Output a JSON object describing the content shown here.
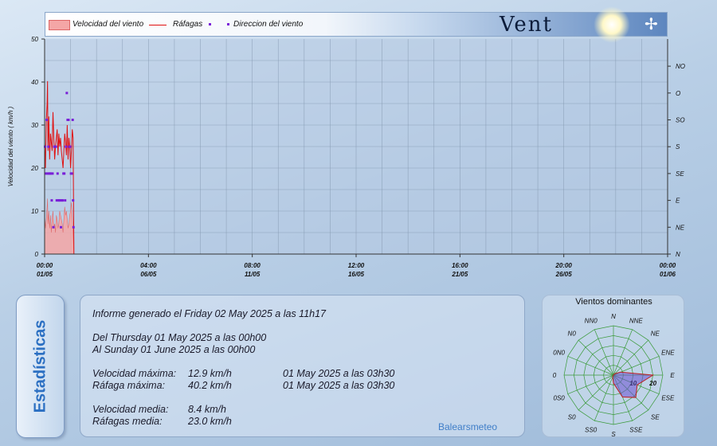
{
  "header": {
    "title": "Vent",
    "legend": [
      {
        "label": "Velocidad del viento",
        "symbol": "area",
        "color": "#f4a6a6"
      },
      {
        "label": "Ráfagas",
        "symbol": "line",
        "color": "#e01010"
      },
      {
        "label": "Direccion del viento",
        "symbol": "dots",
        "color": "#7a20d8"
      }
    ]
  },
  "colors": {
    "speed_fill": "#f4a6a6",
    "gust_line": "#e01010",
    "direction": "#7a20d8",
    "grid": "#7f93ab"
  },
  "chart_data": {
    "type": "line",
    "ylabel": "Velocidad del viento  ( km/h )",
    "ylim": [
      0,
      50
    ],
    "yticks": [
      "0",
      "10",
      "20",
      "30",
      "40",
      "50"
    ],
    "xlim": [
      "2025-05-01 00:00",
      "2025-06-01 00:00"
    ],
    "xticks": [
      {
        "time": "00:00",
        "date": "01/05"
      },
      {
        "time": "04:00",
        "date": "06/05"
      },
      {
        "time": "08:00",
        "date": "11/05"
      },
      {
        "time": "12:00",
        "date": "16/05"
      },
      {
        "time": "16:00",
        "date": "21/05"
      },
      {
        "time": "20:00",
        "date": "26/05"
      },
      {
        "time": "00:00",
        "date": "01/06"
      }
    ],
    "right_axis": {
      "labels": [
        "N",
        "NE",
        "E",
        "SE",
        "S",
        "SO",
        "O",
        "NO"
      ]
    },
    "grid": true,
    "legend": "top",
    "series": [
      {
        "name": "Velocidad del viento",
        "type": "area",
        "x": [
          "2025-05-01 00:00",
          "2025-05-01 01:00",
          "2025-05-01 02:00",
          "2025-05-01 03:00",
          "2025-05-01 03:30",
          "2025-05-01 04:00",
          "2025-05-01 05:00",
          "2025-05-01 06:00",
          "2025-05-01 07:00",
          "2025-05-01 08:00",
          "2025-05-01 09:00",
          "2025-05-01 10:00",
          "2025-05-01 11:00",
          "2025-05-01 12:00",
          "2025-05-01 13:00",
          "2025-05-01 14:00",
          "2025-05-01 15:00",
          "2025-05-01 16:00",
          "2025-05-01 17:00",
          "2025-05-01 18:00",
          "2025-05-01 19:00",
          "2025-05-01 20:00",
          "2025-05-01 21:00",
          "2025-05-01 22:00",
          "2025-05-01 23:00",
          "2025-05-02 00:00",
          "2025-05-02 01:00",
          "2025-05-02 02:00",
          "2025-05-02 03:00",
          "2025-05-02 04:00",
          "2025-05-02 05:00",
          "2025-05-02 06:00",
          "2025-05-02 07:00",
          "2025-05-02 08:00",
          "2025-05-02 09:00",
          "2025-05-02 10:00",
          "2025-05-02 11:00"
        ],
        "values": [
          9,
          6,
          8,
          11,
          12.9,
          7,
          10,
          6,
          9,
          5,
          8,
          10,
          6,
          7,
          5,
          9,
          8,
          6,
          7,
          10,
          9,
          8,
          7,
          5,
          8,
          11,
          9,
          10,
          8,
          6,
          7,
          9,
          10,
          12,
          9,
          5,
          0
        ]
      },
      {
        "name": "Ráfagas",
        "type": "line",
        "x": [
          "2025-05-01 00:00",
          "2025-05-01 01:00",
          "2025-05-01 02:00",
          "2025-05-01 03:00",
          "2025-05-01 03:30",
          "2025-05-01 04:00",
          "2025-05-01 05:00",
          "2025-05-01 06:00",
          "2025-05-01 07:00",
          "2025-05-01 08:00",
          "2025-05-01 09:00",
          "2025-05-01 10:00",
          "2025-05-01 11:00",
          "2025-05-01 12:00",
          "2025-05-01 13:00",
          "2025-05-01 14:00",
          "2025-05-01 15:00",
          "2025-05-01 16:00",
          "2025-05-01 17:00",
          "2025-05-01 18:00",
          "2025-05-01 19:00",
          "2025-05-01 20:00",
          "2025-05-01 21:00",
          "2025-05-01 22:00",
          "2025-05-01 23:00",
          "2025-05-02 00:00",
          "2025-05-02 01:00",
          "2025-05-02 02:00",
          "2025-05-02 03:00",
          "2025-05-02 04:00",
          "2025-05-02 05:00",
          "2025-05-02 06:00",
          "2025-05-02 07:00",
          "2025-05-02 08:00",
          "2025-05-02 09:00",
          "2025-05-02 10:00",
          "2025-05-02 11:00"
        ],
        "values": [
          26,
          20,
          31,
          35,
          40.2,
          24,
          32,
          22,
          28,
          26,
          24,
          33,
          27,
          22,
          25,
          27,
          29,
          23,
          28,
          25,
          27,
          24,
          22,
          20,
          24,
          28,
          26,
          23,
          30,
          22,
          27,
          25,
          20,
          24,
          29,
          27,
          0
        ]
      },
      {
        "name": "Direccion del viento",
        "type": "scatter",
        "points": [
          {
            "x": "2025-05-01 00:30",
            "dir": "S"
          },
          {
            "x": "2025-05-01 01:30",
            "dir": "SE"
          },
          {
            "x": "2025-05-01 02:30",
            "dir": "SO"
          },
          {
            "x": "2025-05-01 03:30",
            "dir": "SE"
          },
          {
            "x": "2025-05-01 04:30",
            "dir": "S"
          },
          {
            "x": "2025-05-01 05:30",
            "dir": "SE"
          },
          {
            "x": "2025-05-01 06:30",
            "dir": "SE"
          },
          {
            "x": "2025-05-01 07:30",
            "dir": "SE"
          },
          {
            "x": "2025-05-01 08:30",
            "dir": "E"
          },
          {
            "x": "2025-05-01 09:30",
            "dir": "SE"
          },
          {
            "x": "2025-05-01 10:30",
            "dir": "NE"
          },
          {
            "x": "2025-05-01 11:30",
            "dir": "S"
          },
          {
            "x": "2025-05-01 12:30",
            "dir": "S"
          },
          {
            "x": "2025-05-01 13:30",
            "dir": "S"
          },
          {
            "x": "2025-05-01 14:30",
            "dir": "E"
          },
          {
            "x": "2025-05-01 15:30",
            "dir": "SE"
          },
          {
            "x": "2025-05-01 16:30",
            "dir": "E"
          },
          {
            "x": "2025-05-01 17:30",
            "dir": "E"
          },
          {
            "x": "2025-05-01 18:30",
            "dir": "E"
          },
          {
            "x": "2025-05-01 19:30",
            "dir": "NE"
          },
          {
            "x": "2025-05-01 20:30",
            "dir": "E"
          },
          {
            "x": "2025-05-01 21:30",
            "dir": "E"
          },
          {
            "x": "2025-05-01 22:30",
            "dir": "SE"
          },
          {
            "x": "2025-05-01 23:30",
            "dir": "SE"
          },
          {
            "x": "2025-05-02 00:30",
            "dir": "E"
          },
          {
            "x": "2025-05-02 01:30",
            "dir": "S"
          },
          {
            "x": "2025-05-02 02:30",
            "dir": "O"
          },
          {
            "x": "2025-05-02 03:30",
            "dir": "SO"
          },
          {
            "x": "2025-05-02 04:30",
            "dir": "SO"
          },
          {
            "x": "2025-05-02 05:30",
            "dir": "S"
          },
          {
            "x": "2025-05-02 06:30",
            "dir": "S"
          },
          {
            "x": "2025-05-02 07:30",
            "dir": "SE"
          },
          {
            "x": "2025-05-02 08:30",
            "dir": "SE"
          },
          {
            "x": "2025-05-02 09:30",
            "dir": "SO"
          },
          {
            "x": "2025-05-02 10:00",
            "dir": "E"
          },
          {
            "x": "2025-05-02 10:30",
            "dir": "NE"
          }
        ]
      }
    ]
  },
  "side_tab": {
    "label": "Estadísticas"
  },
  "stats": {
    "report_line": "Informe generado el Friday 02 May 2025 a las 11h17",
    "from_line": "Del Thursday 01 May 2025 a las 00h00",
    "to_line": "Al Sunday 01 June 2025 a las 00h00",
    "rows": [
      {
        "label": "Velocidad máxima:",
        "value": "12.9 km/h",
        "when": "01 May 2025 a las 03h30"
      },
      {
        "label": "Ráfaga máxima:",
        "value": "40.2 km/h",
        "when": "01 May 2025 a las 03h30"
      },
      {
        "label": "Velocidad media:",
        "value": "8.4 km/h",
        "when": ""
      },
      {
        "label": "Ráfagas media:",
        "value": "23.0 km/h",
        "when": ""
      }
    ],
    "brand": "Balearsmeteo"
  },
  "rose": {
    "title": "Vientos dominantes",
    "directions": [
      "N",
      "NNE",
      "NE",
      "ENE",
      "E",
      "ESE",
      "SE",
      "SSE",
      "S",
      "SSO",
      "SO",
      "OSO",
      "O",
      "ONO",
      "NO",
      "NNO"
    ],
    "direction_labels": [
      "N",
      "NNE",
      "NE",
      "ENE",
      "E",
      "ESE",
      "SE",
      "SSE",
      "S",
      "SS0",
      "S0",
      "0S0",
      "0",
      "0N0",
      "N0",
      "NN0"
    ],
    "ring_labels": [
      "10",
      "20"
    ],
    "rmax": 25,
    "values": [
      0,
      0,
      1,
      4,
      20,
      13,
      16,
      12,
      4,
      1,
      0,
      0,
      0,
      0,
      0,
      0
    ],
    "fill": "#6a50d0",
    "stroke": "#c02020"
  }
}
